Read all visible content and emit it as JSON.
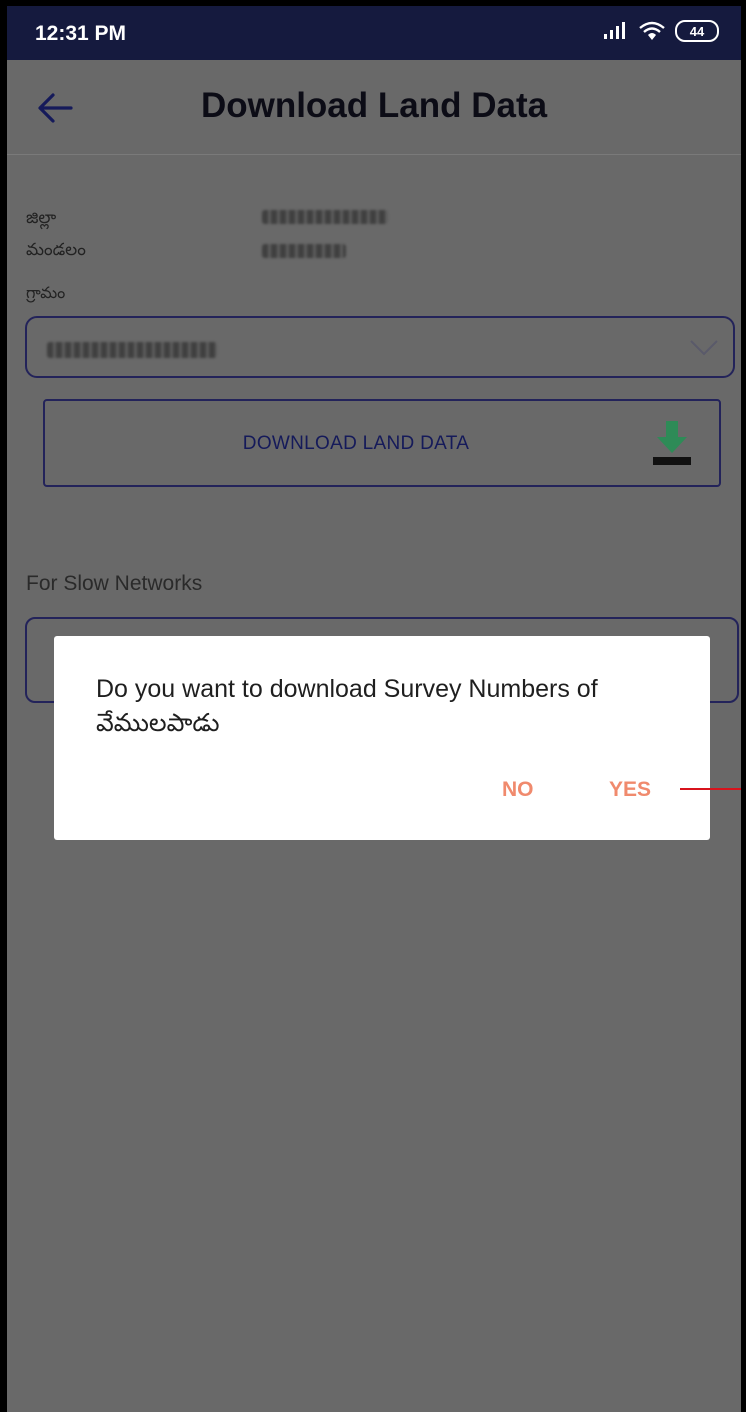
{
  "status_bar": {
    "time": "12:31 PM",
    "battery": "44"
  },
  "app_bar": {
    "title": "Download Land Data"
  },
  "form": {
    "district_label": "జిల్లా",
    "mandal_label": "మండలం",
    "village_label": "గ్రామం",
    "download_button": "DOWNLOAD LAND DATA",
    "slow_networks_heading": "For Slow Networks"
  },
  "dialog": {
    "message": "Do you want to download Survey Numbers of",
    "village_name": "వేములపాడు",
    "no_label": "NO",
    "yes_label": "YES"
  },
  "colors": {
    "primary": "#23235a",
    "status_bar": "#151a3e",
    "accent": "#f08a6d",
    "download_icon": "#2e8b57"
  }
}
